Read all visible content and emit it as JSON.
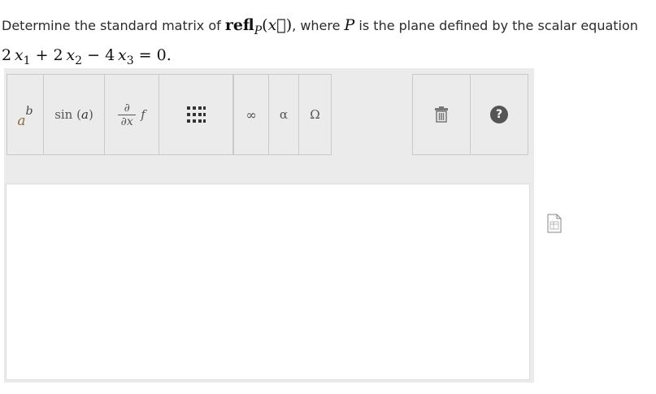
{
  "question": {
    "prefix": "Determine the standard matrix of ",
    "refl_word": "refl",
    "plane_sub": "P",
    "arg_open": "(",
    "vec_x": "x⃗",
    "arg_close": ")",
    "middle": ", where ",
    "plane_var": "P",
    "suffix": " is the plane defined by the scalar equation",
    "eq": {
      "c1": "2",
      "v1": "x",
      "s1": "1",
      "op1": "+",
      "c2": "2",
      "v2": "x",
      "s2": "2",
      "op2": "−",
      "c3": "4",
      "v3": "x",
      "s3": "3",
      "rhs": "= 0."
    }
  },
  "toolbar": {
    "power": {
      "base": "a",
      "exp": "b"
    },
    "trig": {
      "fn": "sin",
      "arg_open": "(",
      "arg": "a",
      "arg_close": ")"
    },
    "partial": {
      "num": "∂",
      "den": "∂x",
      "fn": "f"
    },
    "matrix_icon": "matrix-icon",
    "infinity": "∞",
    "alpha": "α",
    "omega": "Ω",
    "trash_icon": "trash-icon",
    "help": "?"
  },
  "answer": {
    "value": ""
  },
  "colors": {
    "panel": "#ebebeb",
    "border": "#c9c9c9",
    "help_bg": "#555555"
  }
}
